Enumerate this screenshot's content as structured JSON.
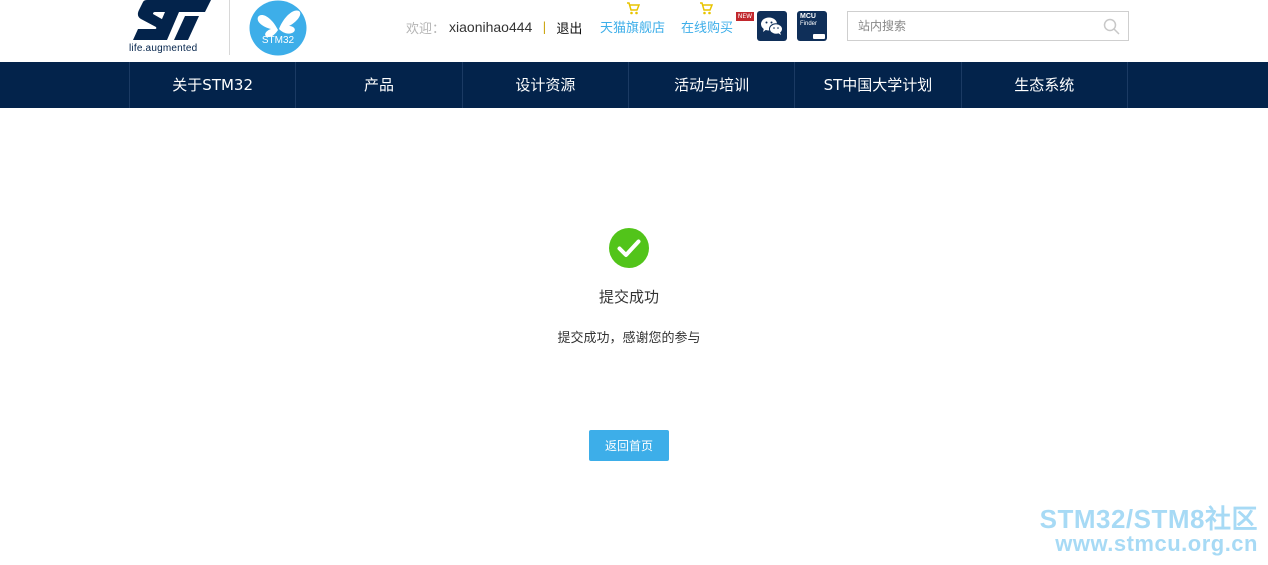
{
  "brand": {
    "st_tagline": "life.augmented",
    "stm32_label": "STM32"
  },
  "userbar": {
    "welcome": "欢迎：",
    "username": "xiaonihao444",
    "separator": "|",
    "logout": "退出"
  },
  "shop_links": {
    "tmall": "天猫旗舰店",
    "online_buy": "在线购买",
    "new_badge": "NEW"
  },
  "mcu_finder": {
    "line1": "MCU",
    "line2": "Finder"
  },
  "search": {
    "placeholder": "站内搜索"
  },
  "nav": {
    "items": [
      {
        "label": "关于STM32"
      },
      {
        "label": "产品"
      },
      {
        "label": "设计资源"
      },
      {
        "label": "活动与培训"
      },
      {
        "label": "ST中国大学计划"
      },
      {
        "label": "生态系统"
      }
    ]
  },
  "result": {
    "title": "提交成功",
    "description": "提交成功，感谢您的参与",
    "button": "返回首页"
  },
  "watermark": {
    "line1": "STM32/STM8社区",
    "line2": "www.stmcu.org.cn"
  },
  "colors": {
    "nav_bg": "#03234b",
    "accent": "#3daee9",
    "success": "#52c41a"
  }
}
